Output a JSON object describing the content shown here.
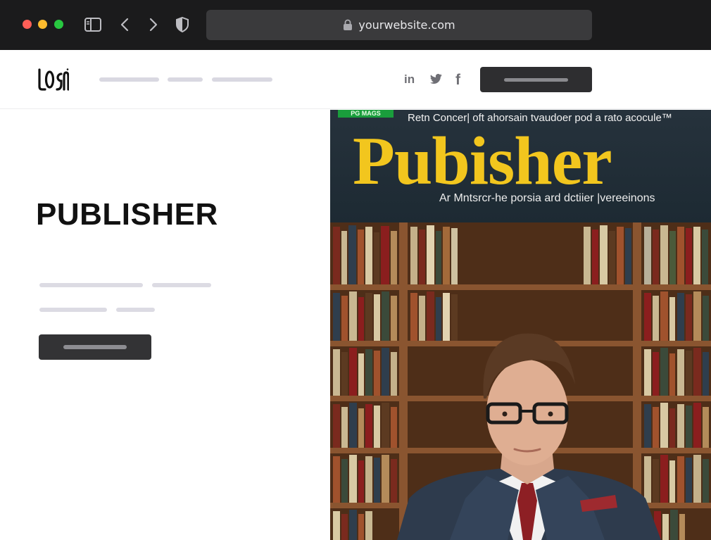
{
  "browser": {
    "url": "yourwebsite.com",
    "traffic_light_colors": [
      "#ff5f57",
      "#febc2e",
      "#28c840"
    ]
  },
  "header": {
    "logo_text": "LOGO",
    "social_icons": [
      "linkedin-icon",
      "twitter-icon",
      "facebook-icon"
    ],
    "social_labels": {
      "linkedin": "in",
      "facebook": "f"
    }
  },
  "hero": {
    "title": "PUBLISHER"
  },
  "cover": {
    "badge": "PG MAGS",
    "tagline": "Retn Concer| oft ahorsain tvaudoer pod a rato acocule™",
    "title": "Pubisher",
    "subtitle": "Ar Mntsrcr-he porsia ard dctiier  |vereeinons"
  },
  "colors": {
    "browser_chrome": "#1b1b1c",
    "url_bar": "#3a3a3c",
    "placeholder_pill": "#d9d8e1",
    "dark_button": "#2e2e30",
    "cover_title": "#f2c61e"
  }
}
